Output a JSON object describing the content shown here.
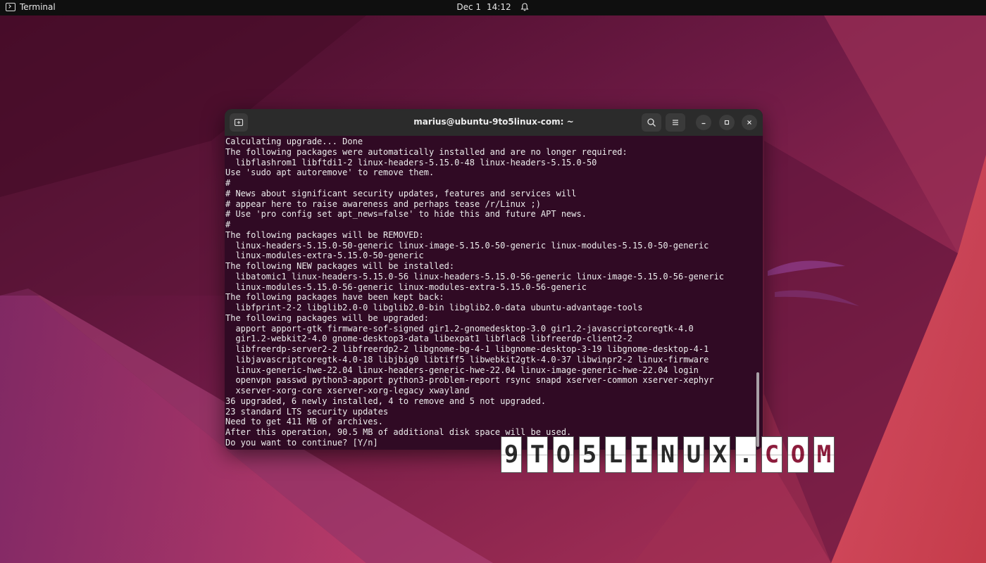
{
  "topbar": {
    "app_name": "Terminal",
    "date": "Dec 1",
    "time": "14:12"
  },
  "terminal": {
    "title": "marius@ubuntu-9to5linux-com: ~",
    "colors": {
      "background": "#300a24",
      "text": "#ececec",
      "headerbar": "#2b2b2b"
    },
    "lines": [
      "Calculating upgrade... Done",
      "The following packages were automatically installed and are no longer required:",
      "  libflashrom1 libftdi1-2 linux-headers-5.15.0-48 linux-headers-5.15.0-50",
      "Use 'sudo apt autoremove' to remove them.",
      "#",
      "# News about significant security updates, features and services will",
      "# appear here to raise awareness and perhaps tease /r/Linux ;)",
      "# Use 'pro config set apt_news=false' to hide this and future APT news.",
      "#",
      "The following packages will be REMOVED:",
      "  linux-headers-5.15.0-50-generic linux-image-5.15.0-50-generic linux-modules-5.15.0-50-generic",
      "  linux-modules-extra-5.15.0-50-generic",
      "The following NEW packages will be installed:",
      "  libatomic1 linux-headers-5.15.0-56 linux-headers-5.15.0-56-generic linux-image-5.15.0-56-generic",
      "  linux-modules-5.15.0-56-generic linux-modules-extra-5.15.0-56-generic",
      "The following packages have been kept back:",
      "  libfprint-2-2 libglib2.0-0 libglib2.0-bin libglib2.0-data ubuntu-advantage-tools",
      "The following packages will be upgraded:",
      "  apport apport-gtk firmware-sof-signed gir1.2-gnomedesktop-3.0 gir1.2-javascriptcoregtk-4.0",
      "  gir1.2-webkit2-4.0 gnome-desktop3-data libexpat1 libflac8 libfreerdp-client2-2",
      "  libfreerdp-server2-2 libfreerdp2-2 libgnome-bg-4-1 libgnome-desktop-3-19 libgnome-desktop-4-1",
      "  libjavascriptcoregtk-4.0-18 libjbig0 libtiff5 libwebkit2gtk-4.0-37 libwinpr2-2 linux-firmware",
      "  linux-generic-hwe-22.04 linux-headers-generic-hwe-22.04 linux-image-generic-hwe-22.04 login",
      "  openvpn passwd python3-apport python3-problem-report rsync snapd xserver-common xserver-xephyr",
      "  xserver-xorg-core xserver-xorg-legacy xwayland",
      "36 upgraded, 6 newly installed, 4 to remove and 5 not upgraded.",
      "23 standard LTS security updates",
      "Need to get 411 MB of archives.",
      "After this operation, 90.5 MB of additional disk space will be used.",
      "Do you want to continue? [Y/n]"
    ]
  },
  "watermark": {
    "letters": [
      "9",
      "T",
      "O",
      "5",
      "L",
      "I",
      "N",
      "U",
      "X",
      ".",
      "C",
      "O",
      "M"
    ],
    "accent_color": "#8c1c3c"
  },
  "icons": {
    "new_tab": "new-tab-icon",
    "search": "search-icon",
    "menu": "hamburger-menu-icon",
    "minimize": "minimize-icon",
    "maximize": "maximize-icon",
    "close": "close-icon",
    "bell": "bell-icon",
    "app": "terminal-app-icon"
  }
}
